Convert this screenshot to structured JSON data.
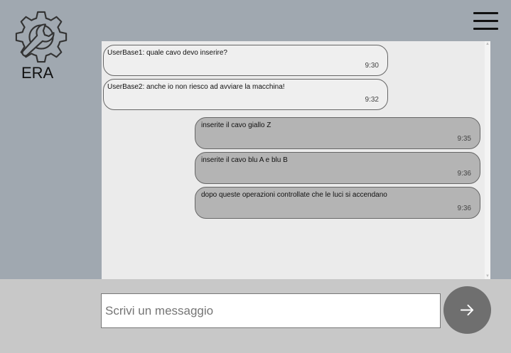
{
  "app": {
    "name": "ERA"
  },
  "icons": {
    "logo": "gear-wrench-icon",
    "menu": "hamburger-menu-icon",
    "send": "arrow-right-icon"
  },
  "colors": {
    "background": "#a0a8b0",
    "chat_bg": "#ebebeb",
    "received_bubble": "#efefef",
    "sent_bubble": "#b4b4b4",
    "send_button": "#6f6f6f"
  },
  "messages": [
    {
      "direction": "received",
      "text": "UserBase1: quale cavo devo inserire?",
      "time": "9:30"
    },
    {
      "direction": "received",
      "text": "UserBase2: anche io non riesco ad avviare la macchina!",
      "time": "9:32"
    },
    {
      "direction": "sent",
      "text": "inserite il cavo giallo Z",
      "time": "9:35"
    },
    {
      "direction": "sent",
      "text": "inserite il cavo blu A e blu B",
      "time": "9:36"
    },
    {
      "direction": "sent",
      "text": "dopo queste operazioni controllate che le luci si accendano",
      "time": "9:36"
    }
  ],
  "composer": {
    "placeholder": "Scrivi un messaggio",
    "value": ""
  }
}
